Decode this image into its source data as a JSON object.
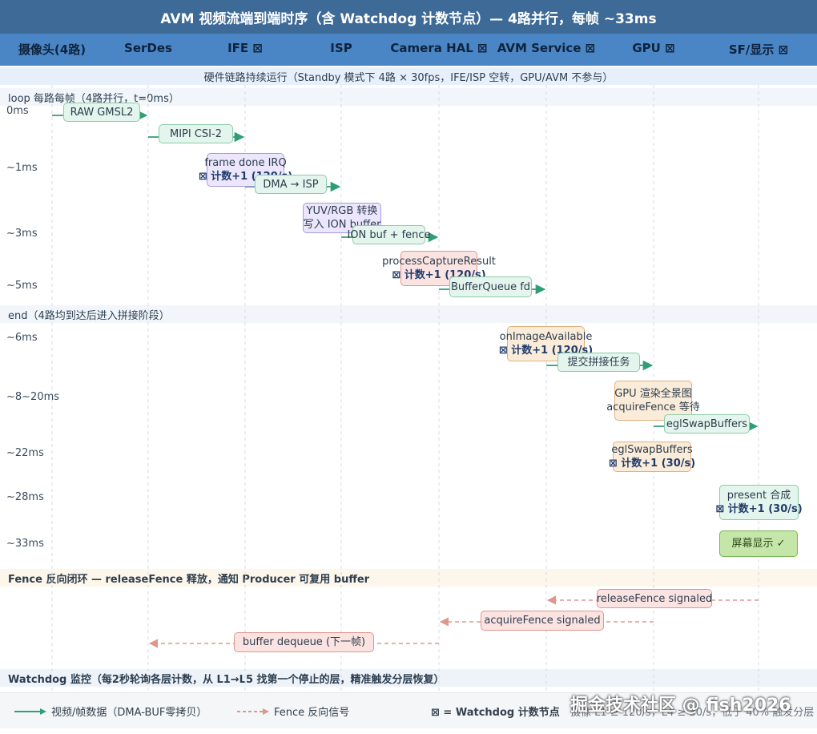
{
  "title": "AVM 视频流端到端时序（含 Watchdog 计数节点）— 4路并行，每帧 ~33ms",
  "lanes": [
    "摄像头(4路)",
    "SerDes",
    "IFE ⊠",
    "ISP",
    "Camera HAL ⊠",
    "AVM Service ⊠",
    "GPU ⊠",
    "SF/显示 ⊠"
  ],
  "bands": {
    "hardware": "硬件链路持续运行（Standby 模式下 4路 × 30fps，IFE/ISP 空转，GPU/AVM 不参与）",
    "loop": "loop 每路每帧（4路并行，t=0ms）",
    "end": "end（4路均到达后进入拼接阶段）",
    "fence": "Fence 反向闭环 — releaseFence 释放，通知 Producer 可复用 buffer",
    "watchdog": "Watchdog 监控（每2秒轮询各层计数，从 L1→L5 找第一个停止的层，精准触发分层恢复）"
  },
  "times": [
    "0ms",
    "~1ms",
    "~3ms",
    "~5ms",
    "~6ms",
    "~8~20ms",
    "~22ms",
    "~28ms",
    "~33ms"
  ],
  "steps": {
    "raw": "RAW GMSL2",
    "mipi": "MIPI CSI-2",
    "frame_done": "frame done IRQ",
    "frame_done_count": "⊠ 计数+1 (120/s)",
    "dma": "DMA → ISP",
    "yuv_line1": "YUV/RGB 转换",
    "yuv_line2": "写入 ION buffer",
    "ion": "ION buf + fence",
    "pcr": "processCaptureResult",
    "pcr_count": "⊠ 计数+1 (120/s)",
    "bq": "BufferQueue fd",
    "oia": "onImageAvailable",
    "oia_count": "⊠ 计数+1 (120/s)",
    "stitch": "提交拼接任务",
    "gpu_line1": "GPU 渲染全景图",
    "gpu_line2": "acquireFence 等待",
    "egl_arrow": "eglSwapBuffers",
    "egl": "eglSwapBuffers",
    "egl_count": "⊠ 计数+1 (30/s)",
    "present": "present 合成",
    "present_count": "⊠ 计数+1 (30/s)",
    "screen": "屏幕显示 ✓",
    "release": "releaseFence signaled",
    "acquire": "acquireFence signaled",
    "dequeue": "buffer dequeue (下一帧)"
  },
  "legend": {
    "solid": "视频/帧数据（DMA-BUF零拷贝）",
    "dashed": "Fence 反向信号",
    "marker": "⊠ = Watchdog 计数节点",
    "partial": "摄像 L1 ≥ 120/s，L4 ≥ 30/s，低于 40% 触发分层"
  },
  "watermark": "掘金技术社区 @ fish2026",
  "colors": {
    "title_bg": "#3d6a96",
    "header_bg": "#4a86c5",
    "data_arrow": "#2f9e74",
    "fence_arrow": "#e0958d"
  }
}
